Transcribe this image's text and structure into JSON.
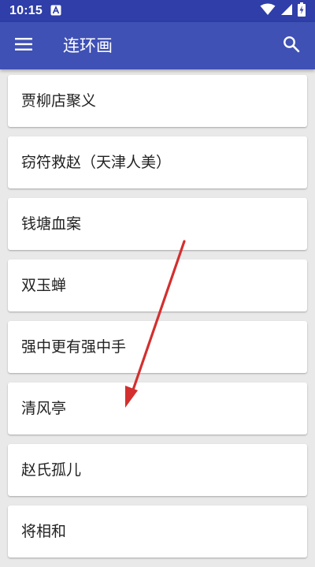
{
  "status_bar": {
    "time": "10:15",
    "icons": [
      "notification-a-icon",
      "wifi-icon",
      "cellular-signal-icon",
      "battery-charging-icon"
    ]
  },
  "app_bar": {
    "title": "连环画",
    "menu_icon": "hamburger-menu-icon",
    "search_icon": "search-icon"
  },
  "list": {
    "items": [
      {
        "label": "贾柳店聚义"
      },
      {
        "label": "窃符救赵（天津人美）"
      },
      {
        "label": "钱塘血案"
      },
      {
        "label": "双玉蝉"
      },
      {
        "label": "强中更有强中手"
      },
      {
        "label": "清风亭"
      },
      {
        "label": "赵氏孤儿"
      },
      {
        "label": "将相和"
      }
    ]
  },
  "colors": {
    "status_bar": "#2f3ea8",
    "app_bar": "#3f51b5",
    "background": "#e9e9e9",
    "card": "#ffffff",
    "annotation_arrow": "#d32f2f"
  }
}
